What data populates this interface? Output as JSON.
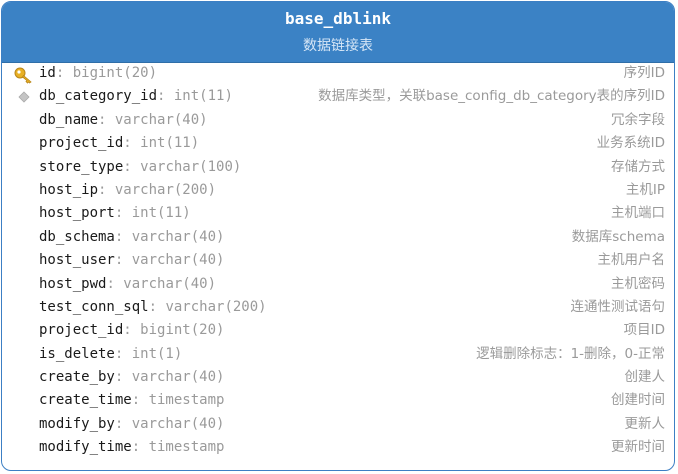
{
  "table": {
    "name": "base_dblink",
    "comment": "数据链接表"
  },
  "columns": [
    {
      "name": "id",
      "type": "bigint(20)",
      "comment": "序列ID",
      "key": "primary",
      "icon": "key-icon"
    },
    {
      "name": "db_category_id",
      "type": "int(11)",
      "comment": "数据库类型，关联base_config_db_category表的序列ID",
      "key": "foreign",
      "icon": "diamond-icon"
    },
    {
      "name": "db_name",
      "type": "varchar(40)",
      "comment": "冗余字段"
    },
    {
      "name": "project_id",
      "type": "int(11)",
      "comment": "业务系统ID"
    },
    {
      "name": "store_type",
      "type": "varchar(100)",
      "comment": "存储方式"
    },
    {
      "name": "host_ip",
      "type": "varchar(200)",
      "comment": "主机IP"
    },
    {
      "name": "host_port",
      "type": "int(11)",
      "comment": "主机端口"
    },
    {
      "name": "db_schema",
      "type": "varchar(40)",
      "comment": "数据库schema"
    },
    {
      "name": "host_user",
      "type": "varchar(40)",
      "comment": "主机用户名"
    },
    {
      "name": "host_pwd",
      "type": "varchar(40)",
      "comment": "主机密码"
    },
    {
      "name": "test_conn_sql",
      "type": "varchar(200)",
      "comment": "连通性测试语句"
    },
    {
      "name": "project_id",
      "type": "bigint(20)",
      "comment": "项目ID"
    },
    {
      "name": "is_delete",
      "type": "int(1)",
      "comment": "逻辑删除标志：1-删除，0-正常"
    },
    {
      "name": "create_by",
      "type": "varchar(40)",
      "comment": "创建人"
    },
    {
      "name": "create_time",
      "type": "timestamp",
      "comment": "创建时间"
    },
    {
      "name": "modify_by",
      "type": "varchar(40)",
      "comment": "更新人"
    },
    {
      "name": "modify_time",
      "type": "timestamp",
      "comment": "更新时间"
    }
  ],
  "colors": {
    "header": "#3b82c5",
    "border": "#3c7fc4",
    "column_name": "#1a1a1a",
    "muted": "#9a9a9a",
    "key": "#e8b024"
  }
}
